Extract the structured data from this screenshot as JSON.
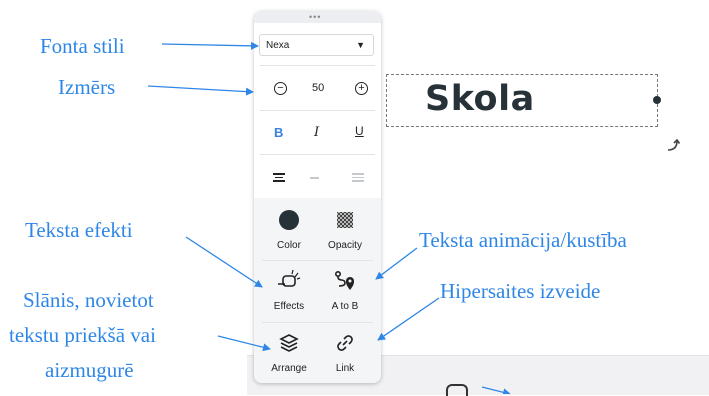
{
  "canvas": {
    "text": "Skola"
  },
  "panel": {
    "font_select": {
      "value": "Nexa"
    },
    "size": {
      "value": "50",
      "decrease_symbol": "−",
      "increase_symbol": "+"
    },
    "format": {
      "bold": "B",
      "italic": "I",
      "underline": "U"
    },
    "tools": [
      {
        "label": "Color",
        "icon": "color-dot-icon"
      },
      {
        "label": "Opacity",
        "icon": "opacity-checker-icon"
      },
      {
        "label": "Effects",
        "icon": "effects-icon"
      },
      {
        "label": "A to B",
        "icon": "path-pin-icon"
      },
      {
        "label": "Arrange",
        "icon": "layers-icon"
      },
      {
        "label": "Link",
        "icon": "link-icon"
      }
    ]
  },
  "annotations": {
    "font_styles": "Fonta stili",
    "size": "Izmērs",
    "text_effects": "Teksta efekti",
    "text_animation": "Teksta animācija/kustība",
    "layer": [
      "Slānis, novietot",
      "tekstu priekšā vai",
      "aizmugurē"
    ],
    "hyperlink": "Hipersaites izveide"
  },
  "colors": {
    "annotation": "#2e86e6",
    "accent_bold": "#3b82e0",
    "text_dark": "#263238"
  }
}
